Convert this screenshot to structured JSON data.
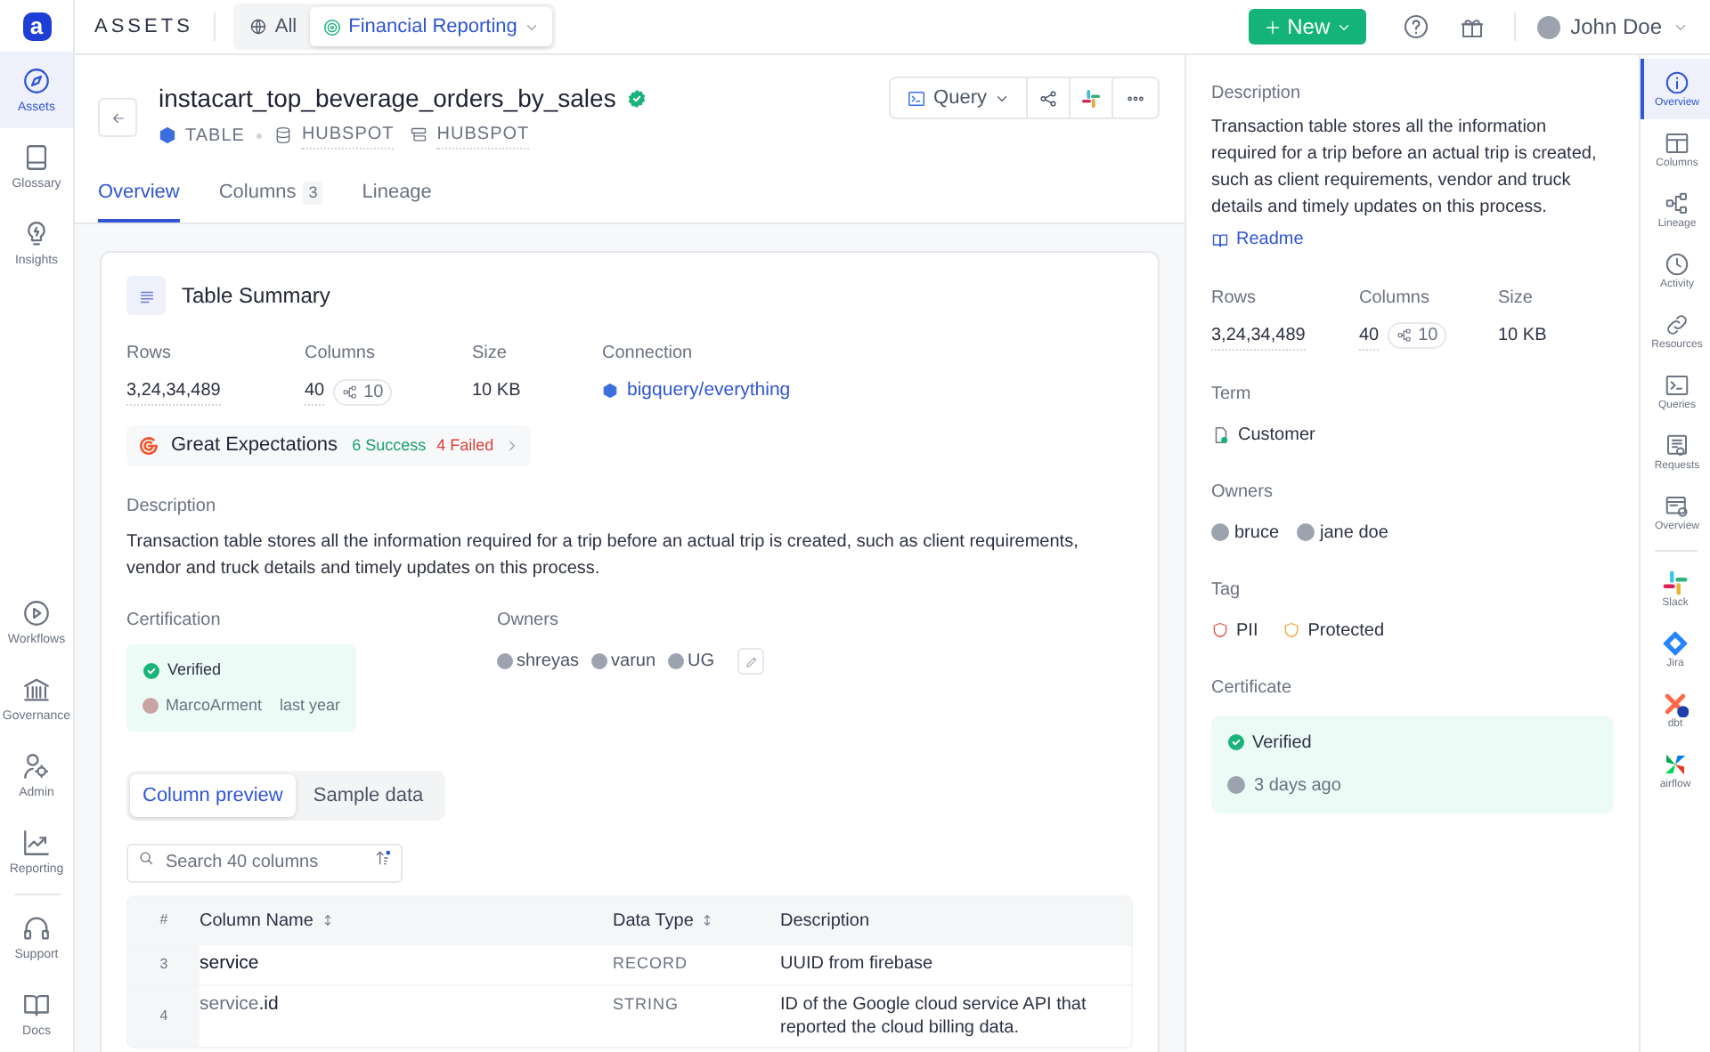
{
  "top_bar": {
    "logo": "a",
    "section": "ASSETS",
    "scopes": [
      {
        "label": "All",
        "selected": false
      },
      {
        "label": "Financial Reporting",
        "selected": true
      }
    ],
    "new_button": "New",
    "user": "John Doe"
  },
  "left_nav": {
    "items": [
      {
        "label": "Assets",
        "selected": true
      },
      {
        "label": "Glossary",
        "selected": false
      },
      {
        "label": "Insights",
        "selected": false
      }
    ],
    "middle_items": [
      {
        "label": "Workflows",
        "selected": false
      },
      {
        "label": "Governance",
        "selected": false
      },
      {
        "label": "Admin",
        "selected": false
      },
      {
        "label": "Reporting",
        "selected": false
      }
    ],
    "bottom_items": [
      {
        "label": "Support",
        "selected": false
      },
      {
        "label": "Docs",
        "selected": false
      }
    ]
  },
  "asset": {
    "name": "instacart_top_beverage_orders_by_sales",
    "verified": true,
    "breadcrumbs": [
      "TABLE",
      "HUBSPOT",
      "HUBSPOT"
    ],
    "query_button": "Query"
  },
  "tabs": [
    {
      "label": "Overview",
      "selected": true
    },
    {
      "label": "Columns",
      "count": "3",
      "selected": false
    },
    {
      "label": "Lineage",
      "selected": false
    }
  ],
  "summary": {
    "title": "Table Summary",
    "stats": [
      {
        "label": "Rows",
        "value": "3,24,34,489"
      },
      {
        "label": "Columns",
        "value": "40",
        "linked": "10"
      },
      {
        "label": "Size",
        "value": "10 KB"
      },
      {
        "label": "Connection",
        "value": "bigquery/everything"
      }
    ],
    "quality": {
      "name": "Great Expectations",
      "success": "6 Success",
      "failed": "4 Failed"
    },
    "description_label": "Description",
    "description": "Transaction table stores all the information required for a trip before an actual trip is created, such as client requirements, vendor and truck details and timely updates on this process.",
    "certification_label": "Certification",
    "certification": {
      "status": "Verified",
      "by": "MarcoArment",
      "when": "last year"
    },
    "owners_label": "Owners",
    "owners": [
      "shreyas",
      "varun",
      "UG"
    ]
  },
  "preview_tabs": [
    {
      "label": "Column preview",
      "selected": true
    },
    {
      "label": "Sample data",
      "selected": false
    }
  ],
  "search": {
    "placeholder": "Search 40 columns"
  },
  "table": {
    "columns": [
      "#",
      "Column Name",
      "Data Type",
      "Description"
    ],
    "rows": [
      {
        "index": "3",
        "name": "service",
        "nested": false,
        "type": "RECORD",
        "description": "UUID from firebase"
      },
      {
        "index": "4",
        "name": "service.id",
        "nested": true,
        "type": "STRING",
        "description": "ID of the Google cloud service API that reported the cloud billing data."
      }
    ]
  },
  "side_panel": {
    "description_label": "Description",
    "description": "Transaction table stores all the information required for a trip before an actual trip is created, such as client requirements, vendor and truck details and timely updates on this process.",
    "readme": "Readme",
    "stats": [
      {
        "label": "Rows",
        "value": "3,24,34,489"
      },
      {
        "label": "Columns",
        "value": "40",
        "linked": "10"
      },
      {
        "label": "Size",
        "value": "10 KB"
      }
    ],
    "term_label": "Term",
    "term": "Customer",
    "owners_label": "Owners",
    "owners": [
      "bruce",
      "jane doe"
    ],
    "tag_label": "Tag",
    "tags": [
      {
        "label": "PII",
        "color": "#e5534b"
      },
      {
        "label": "Protected",
        "color": "#f0a43a"
      }
    ],
    "certificate_label": "Certificate",
    "certificate": {
      "status": "Verified",
      "when": "3 days ago"
    }
  },
  "right_rail": {
    "items": [
      {
        "label": "Overview",
        "selected": true
      },
      {
        "label": "Columns",
        "selected": false
      },
      {
        "label": "Lineage",
        "selected": false
      },
      {
        "label": "Activity",
        "selected": false
      },
      {
        "label": "Resources",
        "selected": false
      },
      {
        "label": "Queries",
        "selected": false
      },
      {
        "label": "Requests",
        "selected": false
      },
      {
        "label": "Overview",
        "selected": false
      }
    ],
    "integrations": [
      "Slack",
      "Jira",
      "dbt",
      "airflow"
    ]
  }
}
